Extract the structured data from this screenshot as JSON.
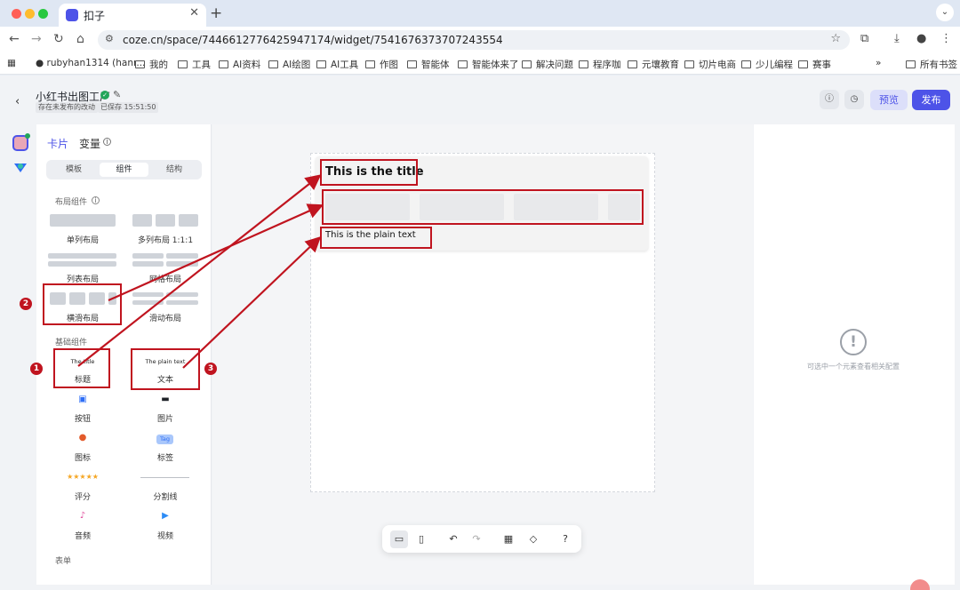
{
  "browser": {
    "tab_title": "扣子",
    "url": "coze.cn/space/7446612776425947174/widget/7541676373707243554",
    "bookmarks": [
      "rubyhan1314 (hanr...",
      "我的",
      "工具",
      "AI资料",
      "AI绘图",
      "AI工具",
      "作图",
      "智能体",
      "智能体来了",
      "解决问题",
      "程序咖",
      "元壤教育",
      "切片电商",
      "少儿编程",
      "赛事"
    ],
    "all_bookmarks": "所有书签",
    "overflow": "»"
  },
  "header": {
    "title": "小红书出图工厂",
    "status_unpublished": "存在未发布的改动",
    "status_saved": "已保存 15:51:50",
    "preview_label": "预览",
    "publish_label": "发布"
  },
  "left_panel": {
    "tab_card": "卡片",
    "tab_variable": "变量",
    "seg_template": "模板",
    "seg_component": "组件",
    "seg_structure": "结构",
    "section_layout": "布局组件",
    "section_basic": "基础组件",
    "section_form": "表单",
    "layout_items": [
      "单列布局",
      "多列布局 1:1:1",
      "列表布局",
      "网格布局",
      "横滑布局",
      "滑动布局"
    ],
    "basic_items": [
      "标题",
      "文本",
      "按钮",
      "图片",
      "图标",
      "标签",
      "评分",
      "分割线",
      "音频",
      "视频"
    ],
    "title_preview": "The title",
    "text_preview": "The plain text",
    "tag_preview": "Tag"
  },
  "canvas": {
    "card_title": "This is the title",
    "card_text": "This is the plain text"
  },
  "right_panel": {
    "hint": "可选中一个元素查看相关配置"
  },
  "annotations": {
    "n1": "1",
    "n2": "2",
    "n3": "3",
    "color": "#c0141f"
  }
}
